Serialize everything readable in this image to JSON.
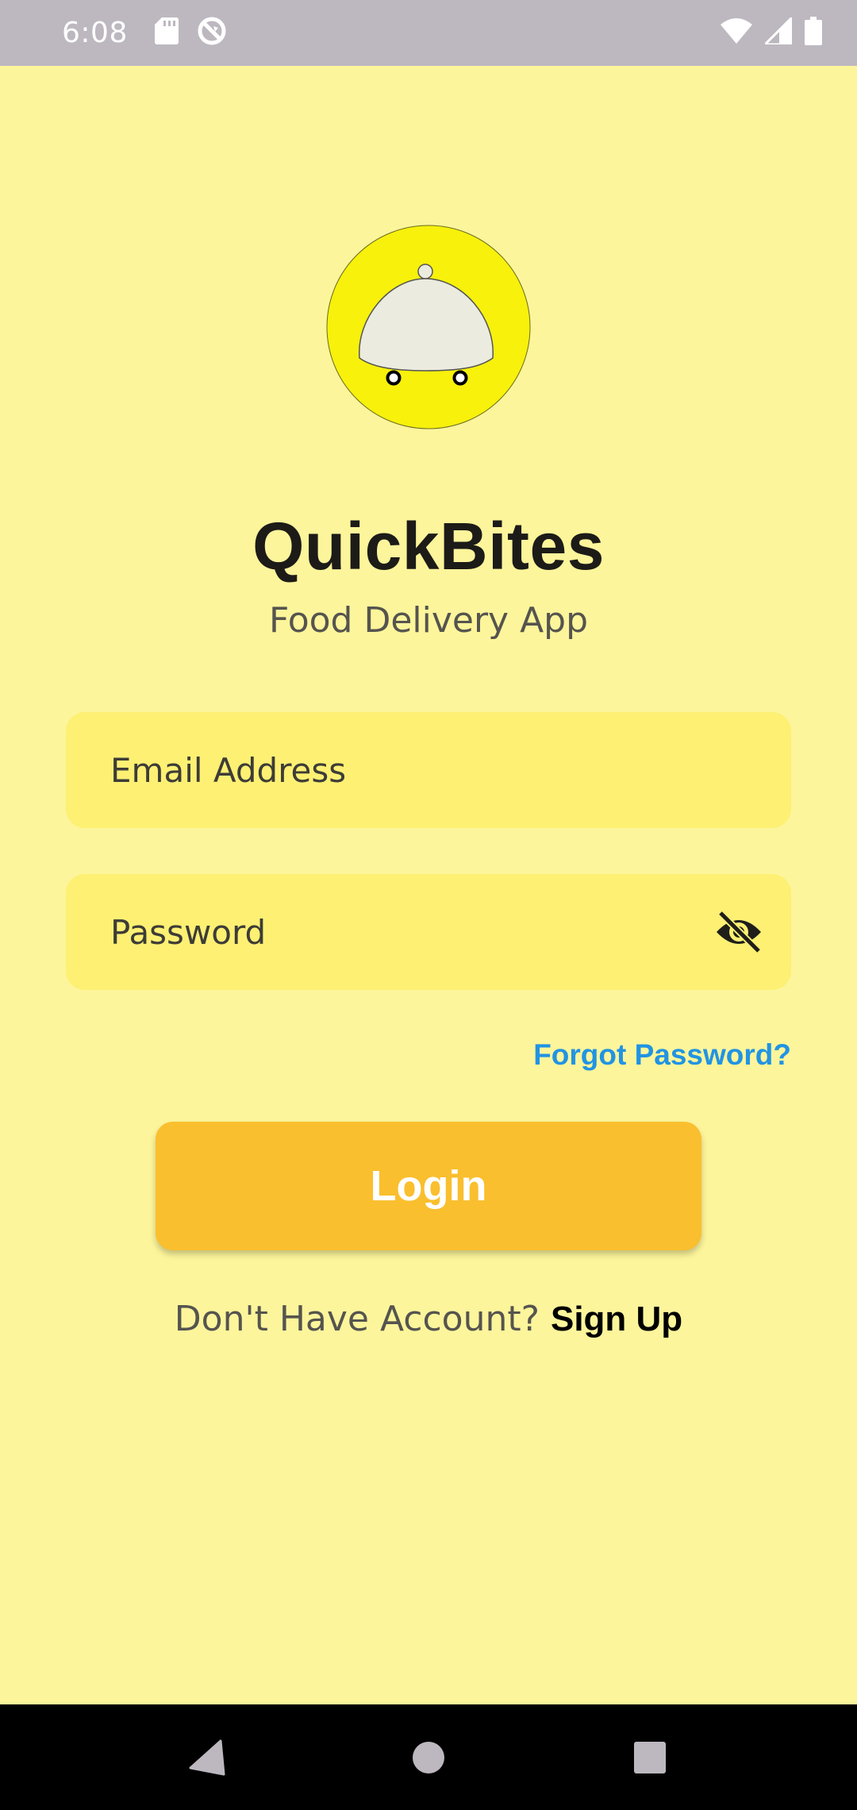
{
  "status_bar": {
    "time": "6:08",
    "left_icons": [
      "sd-card-icon",
      "sync-disabled-icon"
    ],
    "right_icons": [
      "wifi-icon",
      "cell-signal-icon",
      "battery-icon"
    ]
  },
  "app": {
    "logo_icon": "food-cloche-logo-icon",
    "title": "QuickBites",
    "subtitle": "Food Delivery App"
  },
  "login_form": {
    "email_placeholder": "Email Address",
    "email_value": "",
    "password_placeholder": "Password",
    "password_value": "",
    "password_toggle_icon": "visibility-off-icon",
    "forgot_password": "Forgot Password?",
    "login_label": "Login"
  },
  "signup": {
    "prompt": "Don't Have Account?",
    "link": "Sign Up"
  },
  "nav_bar": {
    "icons": [
      "back-icon",
      "home-icon",
      "recents-icon"
    ]
  },
  "colors": {
    "background": "#fdf59b",
    "field_bg": "#fdf073",
    "button": "#fabf2e",
    "link": "#2194e3",
    "logo_circle": "#f7f10b"
  }
}
